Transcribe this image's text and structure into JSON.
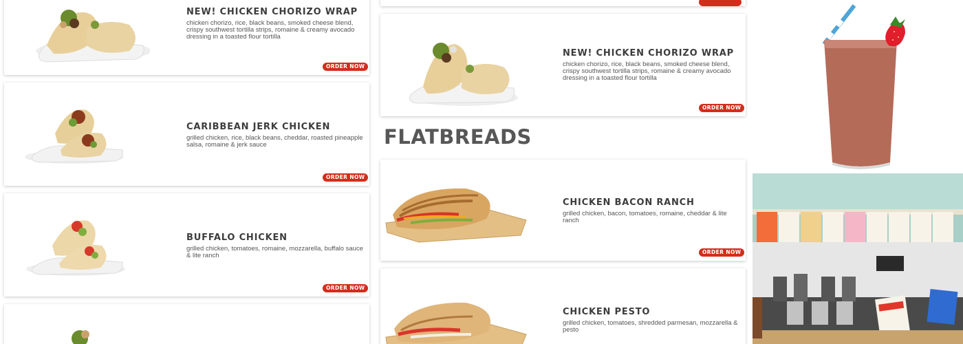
{
  "colors": {
    "accent": "#d32d1c",
    "title": "#3d3d3d",
    "text": "#555555"
  },
  "sections": {
    "flatbreads_heading": "FLATBREADS"
  },
  "wraps": [
    {
      "title": "NEW! CHICKEN CHORIZO WRAP",
      "description": "chicken chorizo, rice, black beans, smoked cheese blend, crispy southwest tortilla strips, romaine & creamy avocado dressing in a toasted flour tortilla",
      "button": "ORDER NOW",
      "image_icon": "wrap-image"
    },
    {
      "title": "CARIBBEAN JERK CHICKEN",
      "description": "grilled chicken, rice, black beans, cheddar, roasted pineapple salsa, romaine & jerk sauce",
      "button": "ORDER NOW",
      "image_icon": "wrap-image"
    },
    {
      "title": "BUFFALO CHICKEN",
      "description": "grilled chicken, tomatoes, romaine, mozzarella, buffalo sauce & lite ranch",
      "button": "ORDER NOW",
      "image_icon": "wrap-image"
    }
  ],
  "middle_wrap": {
    "title": "NEW! CHICKEN CHORIZO WRAP",
    "description": "chicken chorizo, rice, black beans, smoked cheese blend, crispy southwest tortilla strips, romaine & creamy avocado dressing in a toasted flour tortilla",
    "button": "ORDER NOW",
    "image_icon": "wrap-image"
  },
  "flatbreads": [
    {
      "title": "CHICKEN BACON RANCH",
      "description": "grilled chicken, bacon, tomatoes, romaine, cheddar & lite ranch",
      "button": "ORDER NOW",
      "image_icon": "flatbread-image"
    },
    {
      "title": "CHICKEN PESTO",
      "description": "grilled chicken, tomatoes, shredded parmesan, mozzarella & pesto",
      "image_icon": "flatbread-image"
    }
  ],
  "side_images": [
    "smoothie-image",
    "store-interior-image"
  ]
}
